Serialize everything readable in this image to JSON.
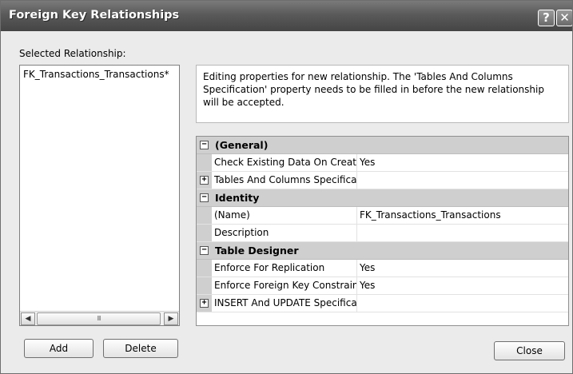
{
  "window": {
    "title": "Foreign Key Relationships",
    "help_glyph": "?",
    "close_glyph": "✕"
  },
  "left_panel": {
    "label": "Selected Relationship:",
    "items": [
      "FK_Transactions_Transactions*"
    ],
    "scrollbar": {
      "left_glyph": "◀",
      "right_glyph": "▶",
      "thumb_grip": "III"
    }
  },
  "info_text": "Editing properties for new relationship.  The 'Tables And Columns Specification' property needs to be filled in before the new relationship will be accepted.",
  "property_grid": {
    "expanded_glyph": "−",
    "collapsed_glyph": "+",
    "categories": [
      {
        "label": "(General)",
        "rows": [
          {
            "name": "Check Existing Data On Creation Or Re-Enabling",
            "value": "Yes",
            "expandable": false
          },
          {
            "name": "Tables And Columns Specification",
            "value": "",
            "expandable": true
          }
        ]
      },
      {
        "label": "Identity",
        "rows": [
          {
            "name": "(Name)",
            "value": "FK_Transactions_Transactions",
            "expandable": false
          },
          {
            "name": "Description",
            "value": "",
            "expandable": false
          }
        ]
      },
      {
        "label": "Table Designer",
        "rows": [
          {
            "name": "Enforce For Replication",
            "value": "Yes",
            "expandable": false
          },
          {
            "name": "Enforce Foreign Key Constraint",
            "value": "Yes",
            "expandable": false
          },
          {
            "name": "INSERT And UPDATE Specification",
            "value": "",
            "expandable": true
          }
        ]
      }
    ]
  },
  "buttons": {
    "add": "Add",
    "delete": "Delete",
    "close": "Close"
  },
  "colors": {
    "titlebar": "#5a5a5a",
    "category_row": "#cfcfcf",
    "dialog_background": "#ebebeb"
  }
}
